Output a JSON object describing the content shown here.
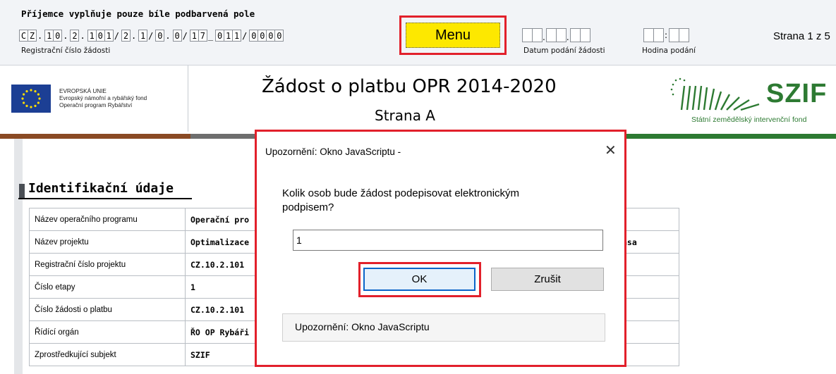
{
  "header": {
    "hint": "Příjemce vyplňuje pouze bíle podbarvená pole",
    "reg_label": "Registrační číslo žádosti",
    "reg_chars": [
      "C",
      "Z",
      ".",
      "1",
      "0",
      ".",
      "2",
      ".",
      "1",
      "0",
      "1",
      "/",
      "2",
      ".",
      "1",
      "/",
      "0",
      ".",
      "0",
      "/",
      "1",
      "7",
      "_",
      "0",
      "1",
      "1",
      "/",
      "0",
      "0",
      "0",
      "0"
    ],
    "menu_label": "Menu",
    "date_label": "Datum podání žádosti",
    "time_label": "Hodina podání",
    "page_info": "Strana 1 z 5"
  },
  "branding": {
    "eu_text_1": "EVROPSKÁ UNIE",
    "eu_text_2": "Evropský námořní a rybářský fond",
    "eu_text_3": "Operační program Rybářství",
    "title": "Žádost o platbu OPR 2014-2020",
    "subtitle": "Strana A",
    "szif_logo": "SZIF",
    "szif_sub": "Státní zemědělský intervenční fond"
  },
  "section": {
    "title": "Identifikační údaje",
    "rows": [
      {
        "label": "Název operačního programu",
        "value": "Operační pro"
      },
      {
        "label": "Název projektu",
        "value": "Optimalizace",
        "value_right": "asa"
      },
      {
        "label": "Registrační číslo projektu",
        "value": "CZ.10.2.101"
      },
      {
        "label": "Číslo etapy",
        "value": "1"
      },
      {
        "label": "Číslo žádosti o platbu",
        "value": "CZ.10.2.101"
      },
      {
        "label": "Řídící orgán",
        "value": "ŘO OP Rybáři"
      },
      {
        "label": "Zprostředkující subjekt",
        "value": "SZIF"
      }
    ]
  },
  "dialog": {
    "title": "Upozornění: Okno JavaScriptu -",
    "close": "✕",
    "message": "Kolik osob bude žádost podepisovat elektronickým podpisem?",
    "input_value": "1",
    "ok_label": "OK",
    "cancel_label": "Zrušit",
    "footer": "Upozornění: Okno JavaScriptu"
  },
  "colors": {
    "highlight": "#e2202b",
    "menu_bg": "#fde800",
    "szif_green": "#2d7a32"
  }
}
